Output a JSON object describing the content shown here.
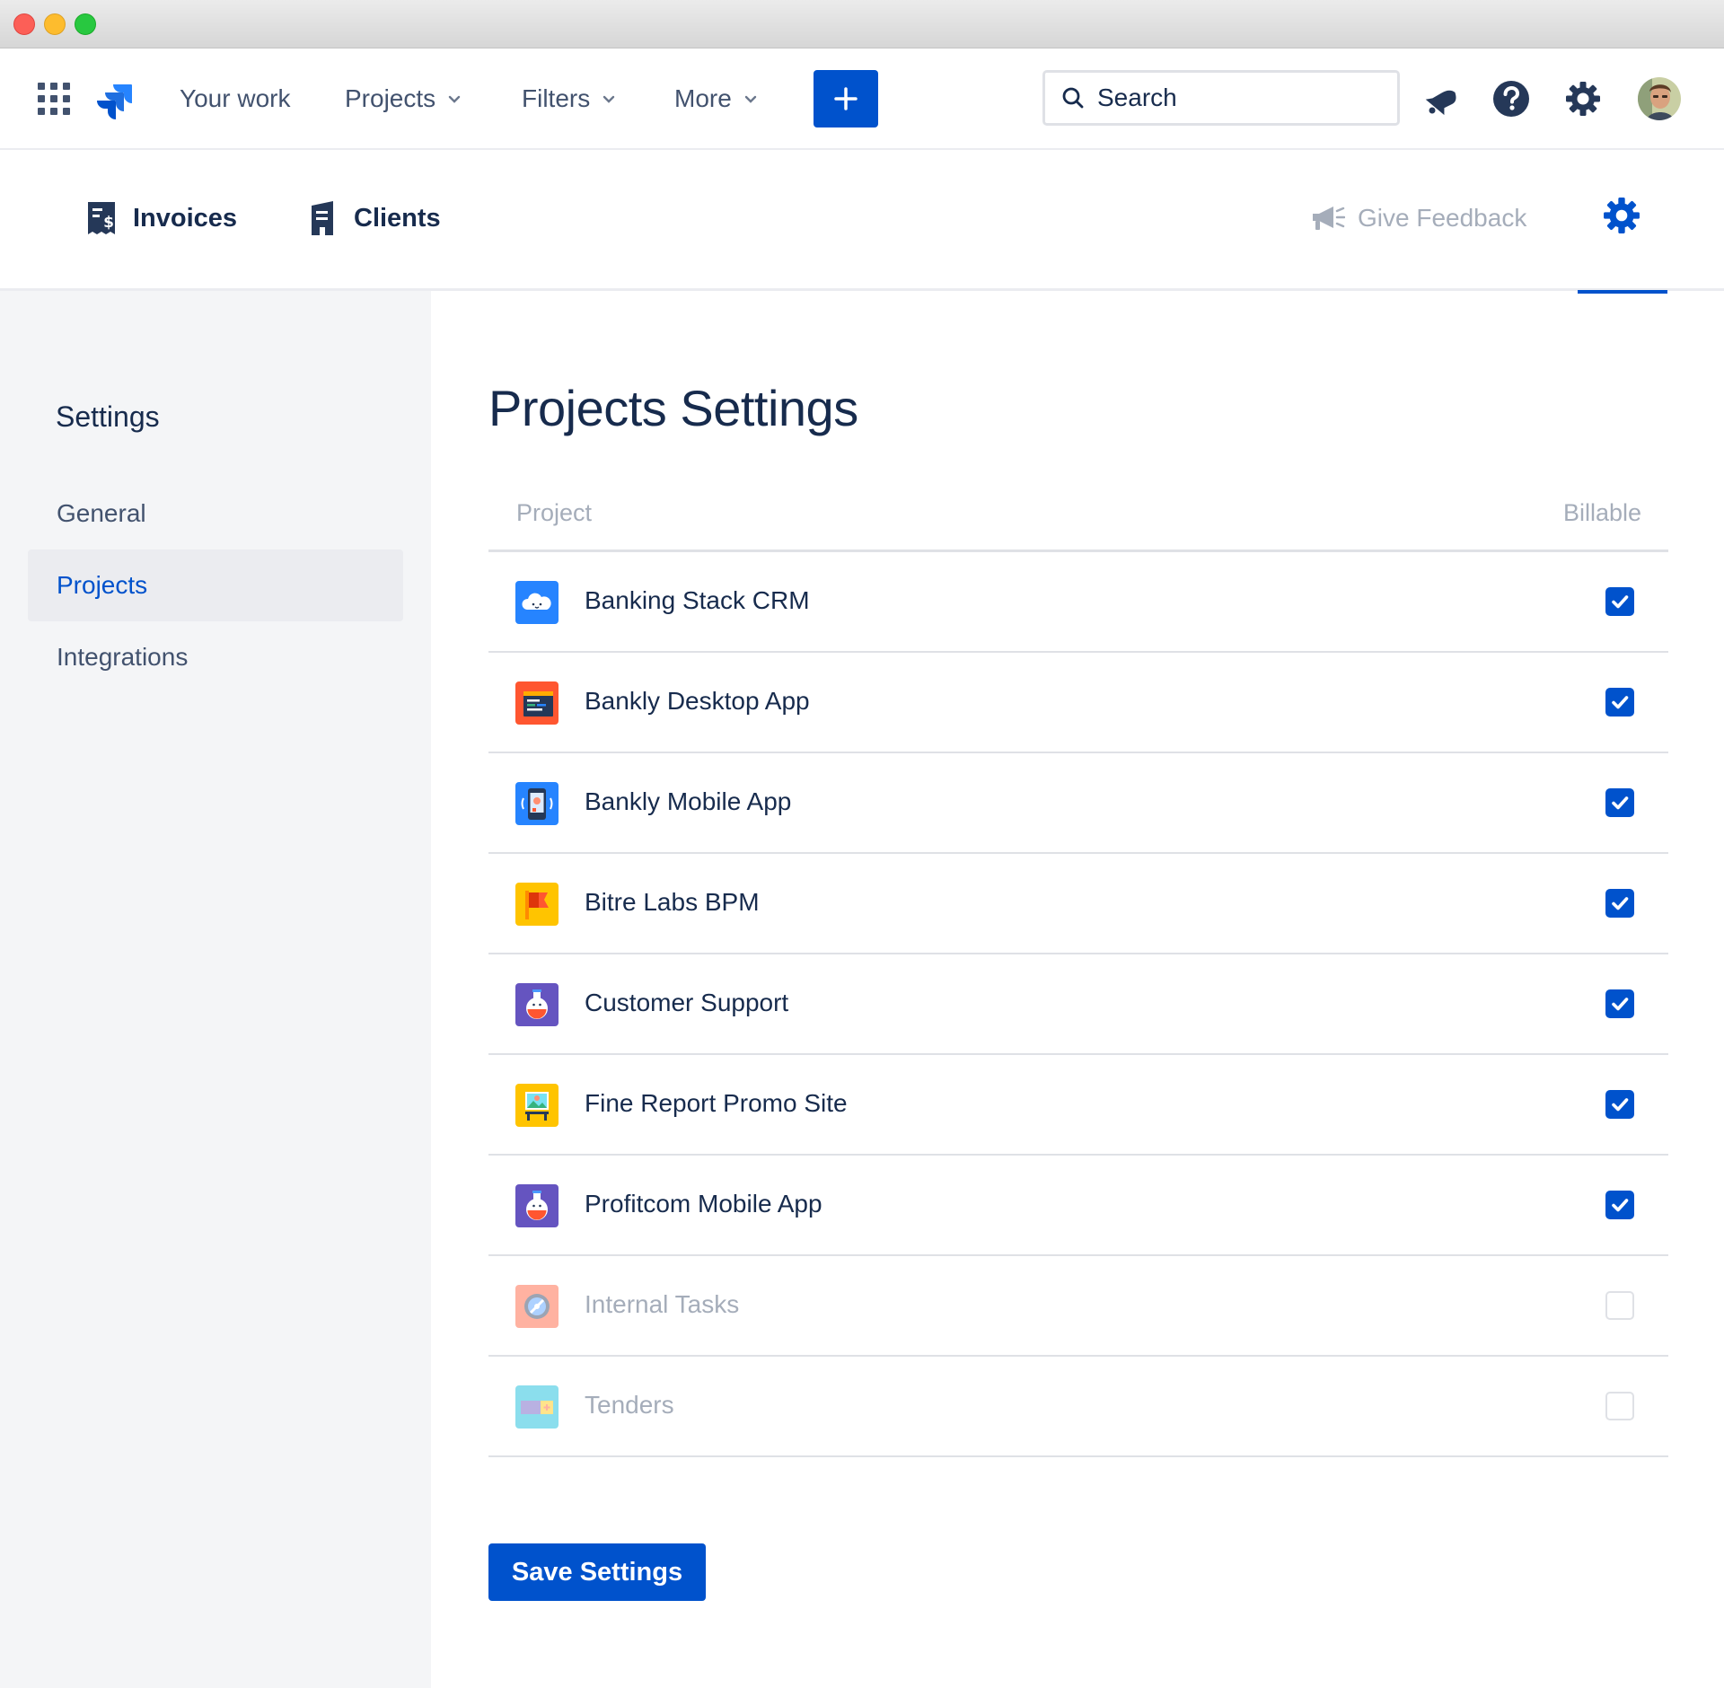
{
  "topnav": {
    "items": [
      {
        "label": "Your work",
        "has_dropdown": false
      },
      {
        "label": "Projects",
        "has_dropdown": true
      },
      {
        "label": "Filters",
        "has_dropdown": true
      },
      {
        "label": "More",
        "has_dropdown": true
      }
    ],
    "search_placeholder": "Search",
    "icons": [
      "apps-grid-icon",
      "jira-logo-icon",
      "plus-icon",
      "search-icon",
      "notification-icon",
      "help-icon",
      "gear-icon",
      "avatar"
    ]
  },
  "subnav": {
    "invoices_label": "Invoices",
    "clients_label": "Clients",
    "feedback_label": "Give Feedback"
  },
  "sidebar": {
    "title": "Settings",
    "items": [
      {
        "label": "General",
        "active": false
      },
      {
        "label": "Projects",
        "active": true
      },
      {
        "label": "Integrations",
        "active": false
      }
    ]
  },
  "main": {
    "title": "Projects Settings",
    "columns": {
      "project": "Project",
      "billable": "Billable"
    },
    "projects": [
      {
        "name": "Banking Stack CRM",
        "billable": true,
        "icon": "cloud-project-icon"
      },
      {
        "name": "Bankly Desktop App",
        "billable": true,
        "icon": "code-window-project-icon"
      },
      {
        "name": "Bankly Mobile App",
        "billable": true,
        "icon": "phone-project-icon"
      },
      {
        "name": "Bitre Labs BPM",
        "billable": true,
        "icon": "flag-project-icon"
      },
      {
        "name": "Customer Support",
        "billable": true,
        "icon": "potion-project-icon"
      },
      {
        "name": "Fine Report Promo Site",
        "billable": true,
        "icon": "picture-project-icon"
      },
      {
        "name": "Profitcom Mobile App",
        "billable": true,
        "icon": "potion-project-icon"
      },
      {
        "name": "Internal Tasks",
        "billable": false,
        "icon": "disc-project-icon"
      },
      {
        "name": "Tenders",
        "billable": false,
        "icon": "ticket-project-icon"
      }
    ],
    "save_label": "Save Settings"
  },
  "colors": {
    "primary": "#0052CC",
    "text": "#172B4D",
    "subtle_text": "#A5ADBA",
    "sidebar_bg": "#F4F5F7"
  }
}
